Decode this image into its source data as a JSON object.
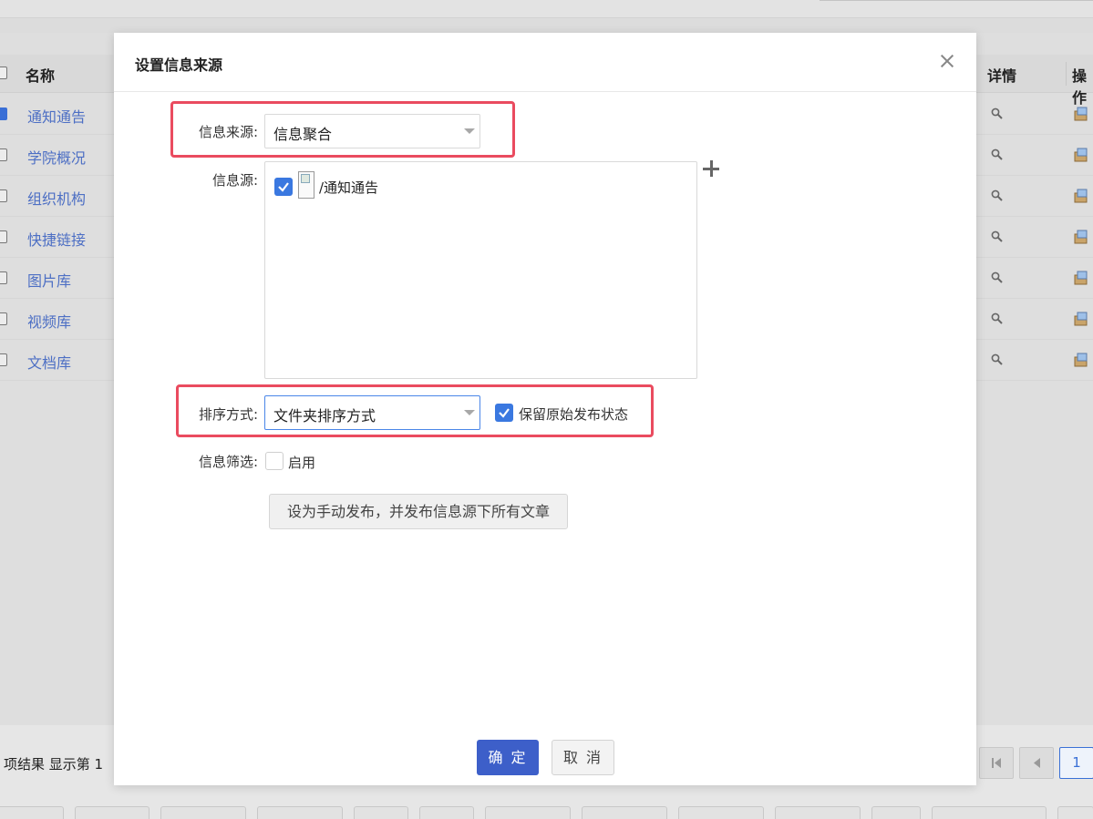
{
  "background": {
    "table": {
      "headers": {
        "name": "名称",
        "detail": "详情",
        "operation": "操作"
      },
      "rows": [
        {
          "name": "通知通告",
          "checked": true
        },
        {
          "name": "学院概况",
          "checked": false
        },
        {
          "name": "组织机构",
          "checked": false
        },
        {
          "name": "快捷链接",
          "checked": false
        },
        {
          "name": "图片库",
          "checked": false
        },
        {
          "name": "视频库",
          "checked": false
        },
        {
          "name": "文档库",
          "checked": false
        }
      ]
    },
    "footer_text": "项结果 显示第 1",
    "pager": {
      "current_page": "1"
    }
  },
  "modal": {
    "title": "设置信息来源",
    "source_type": {
      "label": "信息来源:",
      "value": "信息聚合"
    },
    "sources": {
      "label": "信息源:",
      "items": [
        {
          "path": "/通知通告",
          "checked": true
        }
      ]
    },
    "sort": {
      "label": "排序方式:",
      "value": "文件夹排序方式"
    },
    "keep_status": {
      "label": "保留原始发布状态",
      "checked": true
    },
    "filter": {
      "label": "信息筛选:",
      "checkbox_label": "启用",
      "checked": false
    },
    "manual_publish_button": "设为手动发布，并发布信息源下所有文章",
    "ok_button": "确 定",
    "cancel_button": "取 消"
  },
  "colors": {
    "accent": "#3d5fc9",
    "highlight": "#ea4b5f",
    "link": "#4d6fc4"
  }
}
